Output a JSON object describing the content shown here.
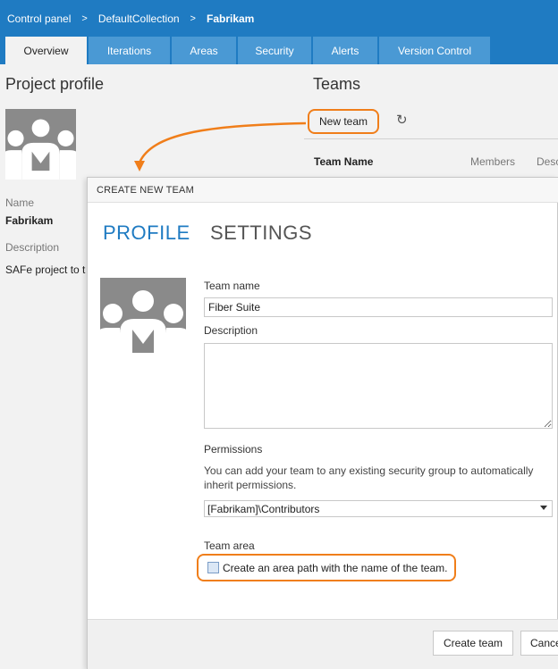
{
  "breadcrumb": {
    "item1": "Control panel",
    "sep": ">",
    "item2": "DefaultCollection",
    "item3": "Fabrikam"
  },
  "tabs": [
    {
      "label": "Overview",
      "active": true
    },
    {
      "label": "Iterations"
    },
    {
      "label": "Areas"
    },
    {
      "label": "Security"
    },
    {
      "label": "Alerts"
    },
    {
      "label": "Version Control"
    }
  ],
  "profile": {
    "heading": "Project profile",
    "name_label": "Name",
    "name_value": "Fabrikam",
    "description_label": "Description",
    "description_value": "SAFe project to t"
  },
  "teams": {
    "heading": "Teams",
    "new_team_label": "New team",
    "refresh_icon": "refresh-icon",
    "col_team_name": "Team Name",
    "col_members": "Members",
    "col_description": "Desc"
  },
  "dialog": {
    "title": "CREATE NEW TEAM",
    "tab_profile": "PROFILE",
    "tab_settings": "SETTINGS",
    "team_name_label": "Team name",
    "team_name_value": "Fiber Suite",
    "description_label": "Description",
    "description_value": "",
    "permissions_label": "Permissions",
    "permissions_help": "You can add your team to any existing security group to automatically inherit permissions.",
    "permissions_selected": "[Fabrikam]\\Contributors",
    "team_area_label": "Team area",
    "area_checkbox_label": "Create an area path with the name of the team.",
    "create_button": "Create team",
    "cancel_button": "Cancel"
  },
  "colors": {
    "accent": "#1f7bc2",
    "tab_inactive": "#4a99d4",
    "highlight": "#f07e1a",
    "avatar": "#8a8a8a"
  }
}
